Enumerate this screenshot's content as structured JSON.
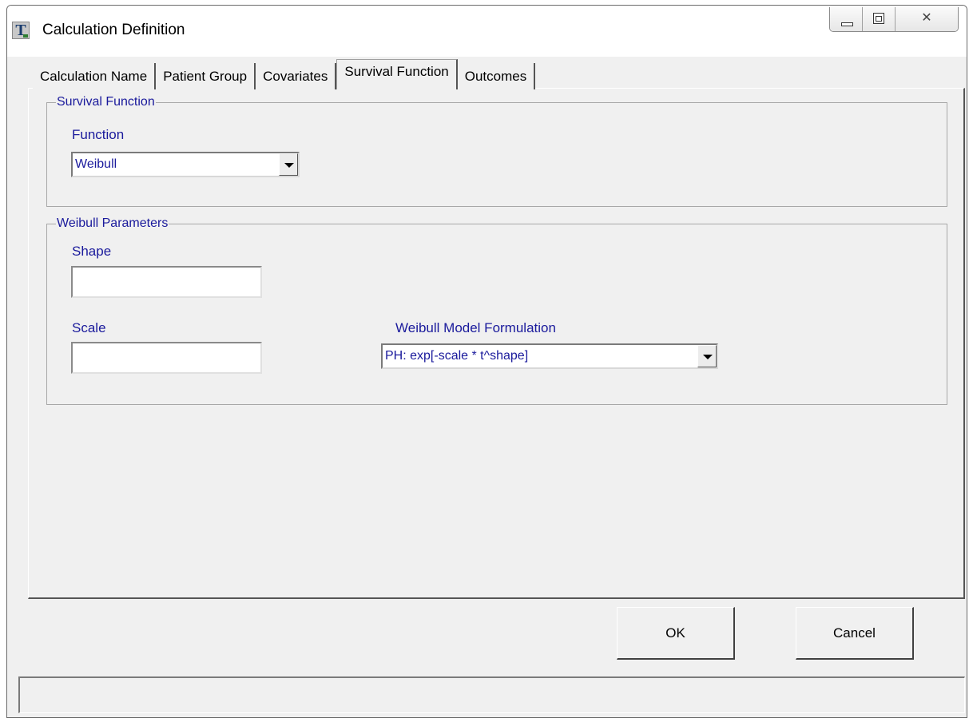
{
  "window": {
    "title": "Calculation Definition",
    "app_icon_letter": "T"
  },
  "tabs": [
    {
      "label": "Calculation Name",
      "active": false
    },
    {
      "label": "Patient Group",
      "active": false
    },
    {
      "label": "Covariates",
      "active": false
    },
    {
      "label": "Survival Function",
      "active": true
    },
    {
      "label": "Outcomes",
      "active": false
    }
  ],
  "survival_function_group": {
    "legend": "Survival Function",
    "function_label": "Function",
    "function_value": "Weibull"
  },
  "weibull_group": {
    "legend": "Weibull Parameters",
    "shape_label": "Shape",
    "shape_value": "",
    "scale_label": "Scale",
    "scale_value": "",
    "formulation_label": "Weibull Model Formulation",
    "formulation_value": "PH:  exp[-scale * t^shape]"
  },
  "buttons": {
    "ok_label": "OK",
    "cancel_label": "Cancel"
  },
  "status_bar": {
    "text": ""
  },
  "colors": {
    "label_text": "#1a1a9c",
    "window_bg": "#f0f0f0"
  },
  "icons": {
    "minimize": "minimize-icon",
    "maximize": "maximize-icon",
    "close": "close-icon",
    "dropdown": "chevron-down-icon"
  }
}
